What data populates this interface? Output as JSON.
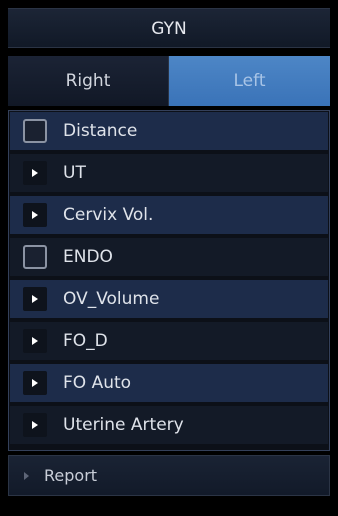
{
  "header": {
    "title": "GYN"
  },
  "side_tabs": [
    {
      "label": "Right",
      "selected": false
    },
    {
      "label": "Left",
      "selected": true
    }
  ],
  "measurements": [
    {
      "label": "Distance",
      "kind": "checkbox",
      "checked": false
    },
    {
      "label": "UT",
      "kind": "expander"
    },
    {
      "label": "Cervix Vol.",
      "kind": "expander"
    },
    {
      "label": "ENDO",
      "kind": "checkbox",
      "checked": false
    },
    {
      "label": "OV_Volume",
      "kind": "expander"
    },
    {
      "label": "FO_D",
      "kind": "expander"
    },
    {
      "label": "FO Auto",
      "kind": "expander"
    },
    {
      "label": "Uterine Artery",
      "kind": "expander"
    }
  ],
  "footer": {
    "report_label": "Report",
    "icon": "caret-right-icon"
  },
  "colors": {
    "background": "#000000",
    "active_tab": "#4a83c4",
    "row_highlight": "#1d2c4a",
    "row_dark": "#131a27",
    "text": "#dfe3ea"
  }
}
